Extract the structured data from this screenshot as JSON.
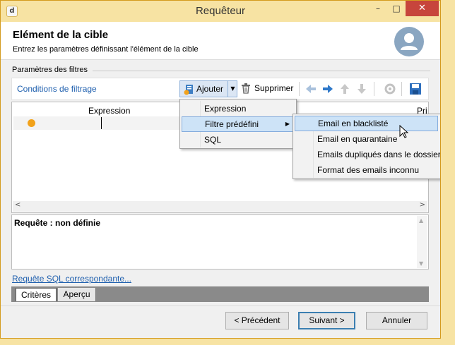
{
  "window": {
    "title": "Requêteur",
    "app_icon": "app-icon",
    "controls": {
      "minimize": "–",
      "maximize": "□",
      "close": "✕"
    }
  },
  "header": {
    "title": "Elément de la cible",
    "subtitle": "Entrez les paramètres définissant l'élément de la cible",
    "avatar_icon": "user-avatar-icon"
  },
  "filters_section": {
    "label": "Paramètres des filtres",
    "toolbar": {
      "label": "Conditions de filtrage",
      "add_label": "Ajouter",
      "delete_label": "Supprimer",
      "icons": [
        "arrow-left-icon",
        "arrow-right-icon",
        "arrow-up-icon",
        "arrow-down-icon",
        "refresh-icon",
        "save-icon"
      ]
    }
  },
  "grid": {
    "columns": [
      "Expression",
      "Pri"
    ]
  },
  "query": {
    "text": "Requête : non définie"
  },
  "sql_link": "Requête SQL correspondante...",
  "tabs": [
    {
      "label": "Critères",
      "active": true
    },
    {
      "label": "Aperçu",
      "active": false
    }
  ],
  "buttons": {
    "previous": "< Précédent",
    "next": "Suivant >",
    "cancel": "Annuler"
  },
  "add_menu": {
    "items": [
      "Expression",
      "Filtre prédéfini",
      "SQL"
    ],
    "highlighted": "Filtre prédéfini"
  },
  "predefined_menu": {
    "items": [
      "Email en blacklisté",
      "Email en quarantaine",
      "Emails dupliqués dans le dossier",
      "Format des emails inconnu"
    ],
    "highlighted": "Email en blacklisté"
  },
  "colors": {
    "title_bar": "#f7e3a3",
    "close_button": "#c7453c",
    "link": "#1e5fae",
    "highlight": "#cde3f7",
    "status_dot": "#f2a21b"
  }
}
